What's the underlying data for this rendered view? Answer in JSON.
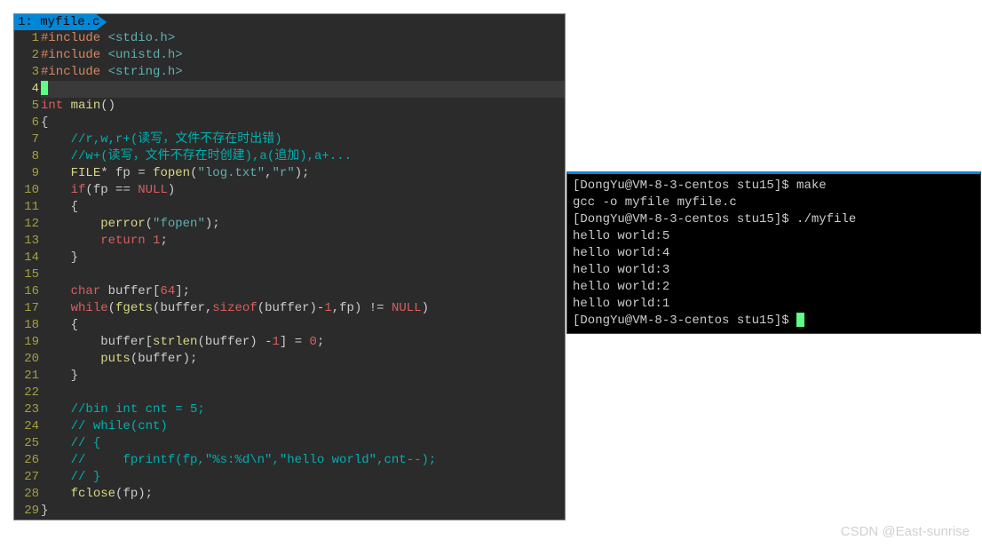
{
  "editor": {
    "tab_label": "1: myfile.c",
    "cursor_line": 4,
    "code": [
      {
        "n": 1,
        "tokens": [
          [
            "pp",
            "#include "
          ],
          [
            "hdr",
            "<stdio.h>"
          ]
        ]
      },
      {
        "n": 2,
        "tokens": [
          [
            "pp",
            "#include "
          ],
          [
            "hdr",
            "<unistd.h>"
          ]
        ]
      },
      {
        "n": 3,
        "tokens": [
          [
            "pp",
            "#include "
          ],
          [
            "hdr",
            "<string.h>"
          ]
        ]
      },
      {
        "n": 4,
        "tokens": [
          [
            "cursor",
            ""
          ]
        ]
      },
      {
        "n": 5,
        "tokens": [
          [
            "kw",
            "int"
          ],
          [
            "op",
            " "
          ],
          [
            "fn",
            "main"
          ],
          [
            "op",
            "()"
          ]
        ]
      },
      {
        "n": 6,
        "tokens": [
          [
            "op",
            "{"
          ]
        ]
      },
      {
        "n": 7,
        "tokens": [
          [
            "op",
            "    "
          ],
          [
            "cm",
            "//r,w,r+(读写，文件不存在时出错)"
          ]
        ]
      },
      {
        "n": 8,
        "tokens": [
          [
            "op",
            "    "
          ],
          [
            "cm",
            "//w+(读写，文件不存在时创建),a(追加),a+..."
          ]
        ]
      },
      {
        "n": 9,
        "tokens": [
          [
            "op",
            "    "
          ],
          [
            "ty",
            "FILE"
          ],
          [
            "op",
            "* "
          ],
          [
            "id",
            "fp"
          ],
          [
            "op",
            " = "
          ],
          [
            "fn",
            "fopen"
          ],
          [
            "op",
            "("
          ],
          [
            "str",
            "\"log.txt\""
          ],
          [
            "op",
            ","
          ],
          [
            "str",
            "\"r\""
          ],
          [
            "op",
            ");"
          ]
        ]
      },
      {
        "n": 10,
        "tokens": [
          [
            "op",
            "    "
          ],
          [
            "kw",
            "if"
          ],
          [
            "op",
            "("
          ],
          [
            "id",
            "fp"
          ],
          [
            "op",
            " == "
          ],
          [
            "const",
            "NULL"
          ],
          [
            "op",
            ")"
          ]
        ]
      },
      {
        "n": 11,
        "tokens": [
          [
            "op",
            "    {"
          ]
        ]
      },
      {
        "n": 12,
        "tokens": [
          [
            "op",
            "        "
          ],
          [
            "fn",
            "perror"
          ],
          [
            "op",
            "("
          ],
          [
            "str",
            "\"fopen\""
          ],
          [
            "op",
            ");"
          ]
        ]
      },
      {
        "n": 13,
        "tokens": [
          [
            "op",
            "        "
          ],
          [
            "kw",
            "return"
          ],
          [
            "op",
            " "
          ],
          [
            "num",
            "1"
          ],
          [
            "op",
            ";"
          ]
        ]
      },
      {
        "n": 14,
        "tokens": [
          [
            "op",
            "    }"
          ]
        ]
      },
      {
        "n": 15,
        "tokens": [
          [
            "op",
            ""
          ]
        ]
      },
      {
        "n": 16,
        "tokens": [
          [
            "op",
            "    "
          ],
          [
            "kw",
            "char"
          ],
          [
            "op",
            " "
          ],
          [
            "id",
            "buffer"
          ],
          [
            "op",
            "["
          ],
          [
            "num",
            "64"
          ],
          [
            "op",
            "];"
          ]
        ]
      },
      {
        "n": 17,
        "tokens": [
          [
            "op",
            "    "
          ],
          [
            "kw",
            "while"
          ],
          [
            "op",
            "("
          ],
          [
            "fn",
            "fgets"
          ],
          [
            "op",
            "("
          ],
          [
            "id",
            "buffer"
          ],
          [
            "op",
            ","
          ],
          [
            "kw",
            "sizeof"
          ],
          [
            "op",
            "("
          ],
          [
            "id",
            "buffer"
          ],
          [
            "op",
            ")-"
          ],
          [
            "num",
            "1"
          ],
          [
            "op",
            ","
          ],
          [
            "id",
            "fp"
          ],
          [
            "op",
            ") != "
          ],
          [
            "const",
            "NULL"
          ],
          [
            "op",
            ")"
          ]
        ]
      },
      {
        "n": 18,
        "tokens": [
          [
            "op",
            "    {"
          ]
        ]
      },
      {
        "n": 19,
        "tokens": [
          [
            "op",
            "        "
          ],
          [
            "id",
            "buffer"
          ],
          [
            "op",
            "["
          ],
          [
            "fn",
            "strlen"
          ],
          [
            "op",
            "("
          ],
          [
            "id",
            "buffer"
          ],
          [
            "op",
            ") -"
          ],
          [
            "num",
            "1"
          ],
          [
            "op",
            "] = "
          ],
          [
            "num",
            "0"
          ],
          [
            "op",
            ";"
          ]
        ]
      },
      {
        "n": 20,
        "tokens": [
          [
            "op",
            "        "
          ],
          [
            "fn",
            "puts"
          ],
          [
            "op",
            "("
          ],
          [
            "id",
            "buffer"
          ],
          [
            "op",
            ");"
          ]
        ]
      },
      {
        "n": 21,
        "tokens": [
          [
            "op",
            "    }"
          ]
        ]
      },
      {
        "n": 22,
        "tokens": [
          [
            "op",
            ""
          ]
        ]
      },
      {
        "n": 23,
        "tokens": [
          [
            "op",
            "    "
          ],
          [
            "cm",
            "//bin int cnt = 5;"
          ]
        ]
      },
      {
        "n": 24,
        "tokens": [
          [
            "op",
            "    "
          ],
          [
            "cm",
            "// while(cnt)"
          ]
        ]
      },
      {
        "n": 25,
        "tokens": [
          [
            "op",
            "    "
          ],
          [
            "cm",
            "// {"
          ]
        ]
      },
      {
        "n": 26,
        "tokens": [
          [
            "op",
            "    "
          ],
          [
            "cm",
            "//     fprintf(fp,\"%s:%d\\n\",\"hello world\",cnt--);"
          ]
        ]
      },
      {
        "n": 27,
        "tokens": [
          [
            "op",
            "    "
          ],
          [
            "cm",
            "// }"
          ]
        ]
      },
      {
        "n": 28,
        "tokens": [
          [
            "op",
            "    "
          ],
          [
            "fn",
            "fclose"
          ],
          [
            "op",
            "("
          ],
          [
            "id",
            "fp"
          ],
          [
            "op",
            ");"
          ]
        ]
      },
      {
        "n": 29,
        "tokens": [
          [
            "op",
            "}"
          ]
        ]
      }
    ]
  },
  "terminal": {
    "lines": [
      "[DongYu@VM-8-3-centos stu15]$ make",
      "gcc -o myfile myfile.c",
      "[DongYu@VM-8-3-centos stu15]$ ./myfile",
      "hello world:5",
      "hello world:4",
      "hello world:3",
      "hello world:2",
      "hello world:1",
      "[DongYu@VM-8-3-centos stu15]$ "
    ]
  },
  "watermark": "CSDN @East-sunrise"
}
